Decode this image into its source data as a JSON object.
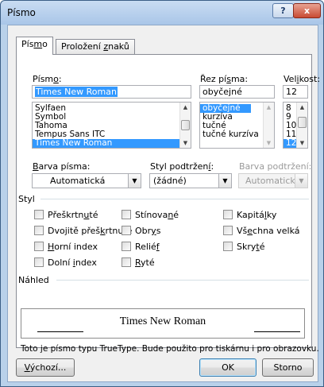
{
  "window": {
    "title": "Písmo",
    "help_label": "?",
    "close_label": "x"
  },
  "tabs": [
    {
      "pre": "Pís",
      "acc": "m",
      "post": "o"
    },
    {
      "pre": "Proložení ",
      "acc": "z",
      "post": "naků"
    }
  ],
  "font": {
    "label_pre": "Písm",
    "label_acc": "o",
    "label_post": ":",
    "value": "Times New Roman",
    "items": [
      "Sylfaen",
      "Symbol",
      "Tahoma",
      "Tempus Sans ITC",
      "Times New Roman"
    ],
    "selected_index": 4
  },
  "style": {
    "label_pre": "Řez pí",
    "label_acc": "s",
    "label_post": "ma:",
    "value": "obyčejné",
    "items": [
      "obyčejné",
      "kurzíva",
      "tučné",
      "tučné kurzíva"
    ],
    "selected_index": 0
  },
  "size": {
    "label_pre": "Vel",
    "label_acc": "i",
    "label_post": "kost:",
    "value": "12",
    "items": [
      "8",
      "9",
      "10",
      "11",
      "12"
    ],
    "selected_index": 4
  },
  "font_color": {
    "label_pre": "",
    "label_acc": "B",
    "label_post": "arva písma:",
    "value": "Automatická"
  },
  "underline_style": {
    "label_pre": "Styl podtržen",
    "label_acc": "í",
    "label_post": ":",
    "value": "(žádné)"
  },
  "underline_color": {
    "label": "Barva podtržení:",
    "value": "Automatická"
  },
  "effects": {
    "group_label": "Styl",
    "items": [
      {
        "pre": "Přeškrtn",
        "acc": "u",
        "post": "té"
      },
      {
        "pre": "Stínova",
        "acc": "n",
        "post": "é"
      },
      {
        "pre": "Kapitá",
        "acc": "l",
        "post": "ky"
      },
      {
        "pre": "Dvojitě přeš",
        "acc": "k",
        "post": "rtnuté"
      },
      {
        "pre": "Obr",
        "acc": "y",
        "post": "s"
      },
      {
        "pre": "Vš",
        "acc": "e",
        "post": "chna velká"
      },
      {
        "pre": "",
        "acc": "H",
        "post": "orní index"
      },
      {
        "pre": "Relié",
        "acc": "f",
        "post": ""
      },
      {
        "pre": "Skry",
        "acc": "t",
        "post": "é"
      },
      {
        "pre": "Dolní ",
        "acc": "i",
        "post": "ndex"
      },
      {
        "pre": "",
        "acc": "R",
        "post": "yté"
      }
    ]
  },
  "preview": {
    "group_label": "Náhled",
    "sample_text": "Times New Roman",
    "description": "Toto je písmo typu TrueType. Bude použito pro tiskárnu i pro obrazovku."
  },
  "buttons": {
    "default": {
      "pre": "",
      "acc": "V",
      "post": "ýchozí..."
    },
    "ok": "OK",
    "cancel": "Storno"
  },
  "colors": {
    "selection": "#3399ff",
    "dialog_frame": "#b9d1ea",
    "close_button": "#c84b33"
  }
}
